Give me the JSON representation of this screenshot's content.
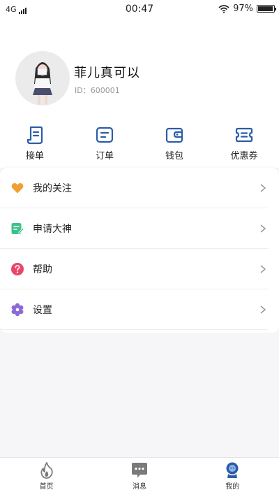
{
  "status_bar": {
    "network": "4G",
    "time": "00:47",
    "battery": "97%",
    "battery_level": 0.97
  },
  "profile": {
    "name": "菲儿真可以",
    "id_text": "ID：600001"
  },
  "quick_actions": [
    {
      "label": "接单",
      "icon": "order-accept-icon"
    },
    {
      "label": "订单",
      "icon": "orders-icon"
    },
    {
      "label": "钱包",
      "icon": "wallet-icon"
    },
    {
      "label": "优惠券",
      "icon": "coupon-icon"
    }
  ],
  "menu": [
    {
      "label": "我的关注",
      "icon": "heart-icon",
      "color": "#f0a030"
    },
    {
      "label": "申请大神",
      "icon": "apply-edit-icon",
      "color": "#3cc28c"
    },
    {
      "label": "帮助",
      "icon": "help-icon",
      "color": "#e8476a"
    },
    {
      "label": "设置",
      "icon": "gear-icon",
      "color": "#8c6ad6"
    }
  ],
  "tab_bar": [
    {
      "label": "首页",
      "icon": "flame-icon"
    },
    {
      "label": "消息",
      "icon": "message-icon"
    },
    {
      "label": "我的",
      "icon": "profile-icon",
      "active": true
    }
  ],
  "colors": {
    "accent": "#2a5da8",
    "icon_gray": "#7a7a7a"
  }
}
